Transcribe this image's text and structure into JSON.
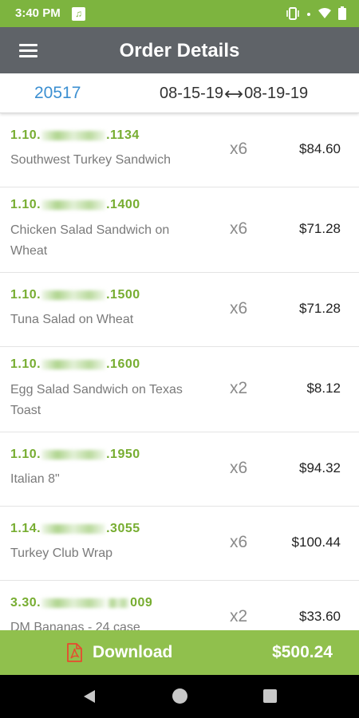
{
  "status_bar": {
    "time": "3:40 PM",
    "icons": [
      "app-notification-icon",
      "vibrate-icon",
      "signal-dot-icon",
      "wifi-icon",
      "battery-icon"
    ]
  },
  "header": {
    "title": "Order Details",
    "menu_icon": "hamburger-menu-icon"
  },
  "order": {
    "number": "20517",
    "start_date": "08-15-19",
    "end_date": "08-19-19"
  },
  "items": [
    {
      "code_prefix": "1.10.",
      "code_suffix": ".1134",
      "name": "Southwest Turkey Sandwich",
      "qty": "x6",
      "price": "$84.60"
    },
    {
      "code_prefix": "1.10.",
      "code_suffix": ".1400",
      "name": "Chicken Salad Sandwich on Wheat",
      "qty": "x6",
      "price": "$71.28"
    },
    {
      "code_prefix": "1.10.",
      "code_suffix": ".1500",
      "name": "Tuna Salad on Wheat",
      "qty": "x6",
      "price": "$71.28"
    },
    {
      "code_prefix": "1.10.",
      "code_suffix": ".1600",
      "name": "Egg Salad Sandwich on Texas Toast",
      "qty": "x2",
      "price": "$8.12"
    },
    {
      "code_prefix": "1.10.",
      "code_suffix": ".1950",
      "name": "Italian 8\"",
      "qty": "x6",
      "price": "$94.32"
    },
    {
      "code_prefix": "1.14.",
      "code_suffix": ".3055",
      "name": "Turkey Club Wrap",
      "qty": "x6",
      "price": "$100.44"
    },
    {
      "code_prefix": "3.30.",
      "code_suffix": "009",
      "name": "DM Bananas - 24 case",
      "qty": "x2",
      "price": "$33.60"
    }
  ],
  "footer": {
    "download_label": "Download",
    "download_icon": "pdf-icon",
    "total": "$500.24"
  },
  "colors": {
    "status_bar": "#7db43f",
    "app_bar": "#5f6368",
    "accent_green": "#77ad31",
    "order_number_blue": "#3b8fd1",
    "footer_green": "#90c04d",
    "pdf_red": "#e8492f"
  }
}
